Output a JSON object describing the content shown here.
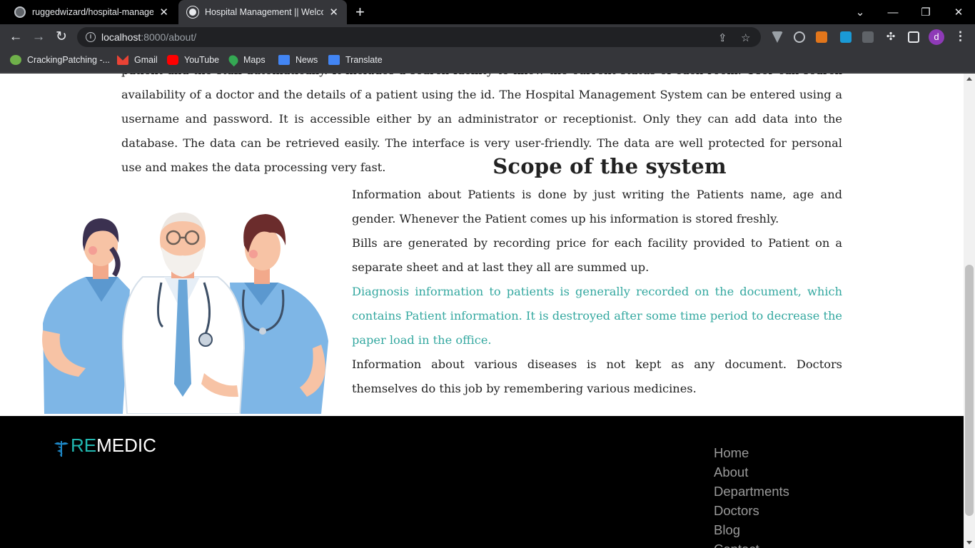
{
  "browser": {
    "tabs": [
      {
        "title": "ruggedwizard/hospital-managem",
        "active": false
      },
      {
        "title": "Hospital Management || Welcom",
        "active": true
      }
    ],
    "url": {
      "host": "localhost",
      "path": ":8000/about/"
    },
    "bookmarks": [
      "CrackingPatching -...",
      "Gmail",
      "YouTube",
      "Maps",
      "News",
      "Translate"
    ],
    "profile_initial": "d"
  },
  "page": {
    "intro_text": "patient and the staff automatically. It includes a search facility to know the current status of each room. User can search availability of a doctor and the details of a patient using the id. The Hospital Management System can be entered using a username and password. It is accessible either by an administrator or receptionist. Only they can add data into the database. The data can be retrieved easily. The interface is very user-friendly. The data are well protected for personal use and makes the data processing very fast.",
    "scope": {
      "title": "Scope of the system",
      "paragraphs": [
        "Information about Patients is done by just writing the Patients name, age and gender. Whenever the Patient comes up his information is stored freshly.",
        "Bills are generated by recording price for each facility provided to Patient on a separate sheet and at last they all are summed up.",
        "Diagnosis information to patients is generally recorded on the document, which contains Patient information. It is destroyed after some time period to decrease the paper load in the office.",
        "Information about various diseases is not kept as any document. Doctors themselves do this job by remembering various medicines."
      ],
      "highlight_color": "#34a8a0"
    }
  },
  "footer": {
    "logo": {
      "accent": "RE",
      "rest": "MEDIC"
    },
    "links": [
      "Home",
      "About",
      "Departments",
      "Doctors",
      "Blog",
      "Contact"
    ]
  }
}
